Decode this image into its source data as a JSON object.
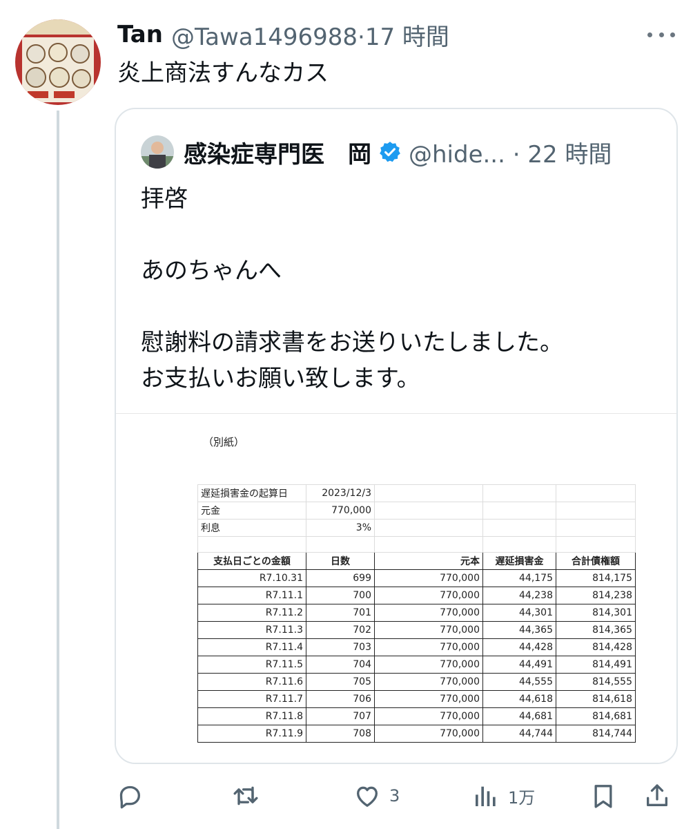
{
  "tweet": {
    "author_name": "Tan",
    "handle_time": "@Tawa1496988·17 時間",
    "text": "炎上商法すんなカス",
    "avatar_icon": "menu-photo-avatar",
    "more_icon": "more-dots-icon"
  },
  "quote": {
    "author_name": "感染症専門医　岡",
    "verified_icon": "verified-badge-icon",
    "verified_color": "#1d9bf0",
    "handle_time": "@hide... · 22 時間",
    "body": "拝啓\n\nあのちゃんへ\n\n慰謝料の請求書をお送りいたしました。\nお支払いお願い致します。",
    "document": {
      "label": "（別紙）",
      "info_rows": [
        [
          "遅延損害金の起算日",
          "2023/12/3"
        ],
        [
          "元金",
          "770,000"
        ],
        [
          "利息",
          "3%"
        ]
      ],
      "headers": [
        "支払日ごとの金額",
        "日数",
        "元本",
        "遅延損害金",
        "合計債権額"
      ],
      "rows": [
        [
          "R7.10.31",
          "699",
          "770,000",
          "44,175",
          "814,175"
        ],
        [
          "R7.11.1",
          "700",
          "770,000",
          "44,238",
          "814,238"
        ],
        [
          "R7.11.2",
          "701",
          "770,000",
          "44,301",
          "814,301"
        ],
        [
          "R7.11.3",
          "702",
          "770,000",
          "44,365",
          "814,365"
        ],
        [
          "R7.11.4",
          "703",
          "770,000",
          "44,428",
          "814,428"
        ],
        [
          "R7.11.5",
          "704",
          "770,000",
          "44,491",
          "814,491"
        ],
        [
          "R7.11.6",
          "705",
          "770,000",
          "44,555",
          "814,555"
        ],
        [
          "R7.11.7",
          "706",
          "770,000",
          "44,618",
          "814,618"
        ],
        [
          "R7.11.8",
          "707",
          "770,000",
          "44,681",
          "814,681"
        ],
        [
          "R7.11.9",
          "708",
          "770,000",
          "44,744",
          "814,744"
        ]
      ]
    }
  },
  "actions": {
    "reply_icon": "reply-icon",
    "retweet_icon": "retweet-icon",
    "like_icon": "heart-icon",
    "like_count": "3",
    "views_icon": "views-chart-icon",
    "views_count": "1万",
    "bookmark_icon": "bookmark-icon",
    "share_icon": "share-icon",
    "icon_color": "#536471"
  }
}
